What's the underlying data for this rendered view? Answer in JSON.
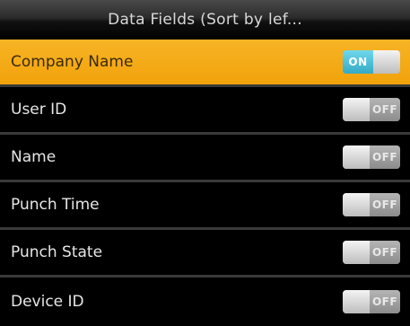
{
  "header": {
    "title": "Data Fields (Sort by lef..."
  },
  "rows": [
    {
      "label": "Company Name",
      "state": "ON"
    },
    {
      "label": "User ID",
      "state": "OFF"
    },
    {
      "label": "Name",
      "state": "OFF"
    },
    {
      "label": "Punch Time",
      "state": "OFF"
    },
    {
      "label": "Punch State",
      "state": "OFF"
    },
    {
      "label": "Device ID",
      "state": "OFF"
    }
  ],
  "colors": {
    "selected_row": "#f5ad18",
    "toggle_on": "#4cc3dc",
    "toggle_off": "#a0a0a0",
    "background": "#000000"
  }
}
